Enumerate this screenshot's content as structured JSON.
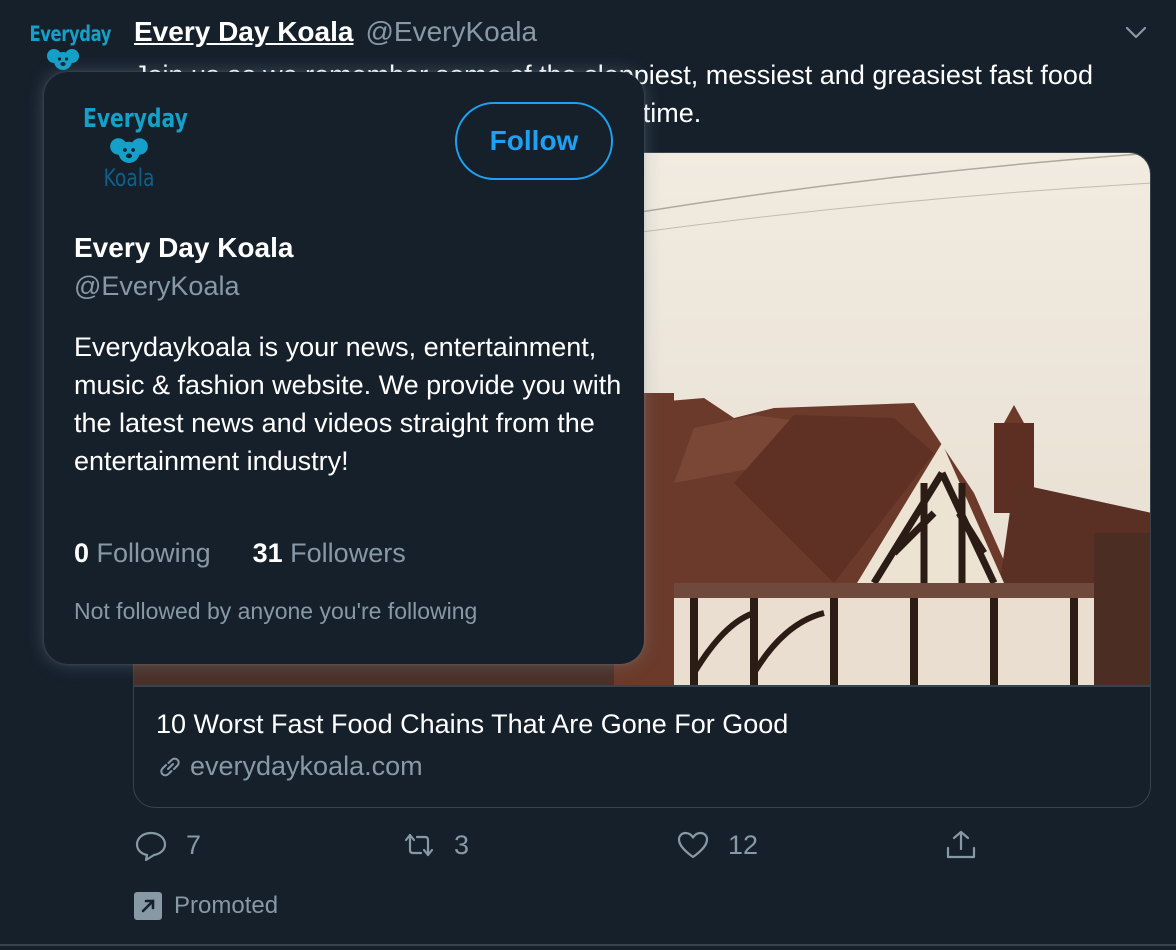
{
  "tweet": {
    "avatar": {
      "logo_top": "Everyday"
    },
    "display_name": "Every Day Koala",
    "handle": "@EveryKoala",
    "more_icon": "chevron-down-icon",
    "text": "Join us as we remember some of the sloppiest, messiest and greasiest fast food chains that are forever lost in the sands of time."
  },
  "card": {
    "title": "10 Worst Fast Food Chains That Are Gone For Good",
    "domain": "everydaykoala.com",
    "domain_icon": "link-icon"
  },
  "actions": {
    "reply_count": "7",
    "retweet_count": "3",
    "like_count": "12",
    "icons": [
      "reply-icon",
      "retweet-icon",
      "like-icon",
      "share-icon"
    ]
  },
  "promoted": {
    "label": "Promoted",
    "icon": "promoted-arrow-icon"
  },
  "hovercard": {
    "logo_top": "Everyday",
    "logo_bottom": "Koala",
    "follow_label": "Follow",
    "name": "Every Day Koala",
    "handle": "@EveryKoala",
    "bio": "Everydaykoala is your news, entertainment, music & fashion website. We provide you with the latest news and videos straight from the entertainment industry!",
    "following_count": "0",
    "following_label": "Following",
    "followers_count": "31",
    "followers_label": "Followers",
    "note": "Not followed by anyone you're following"
  },
  "colors": {
    "background": "#15202b",
    "border": "#38444d",
    "secondary_text": "#8899a6",
    "accent": "#1da1f2",
    "logo_blue": "#14a0c8"
  }
}
